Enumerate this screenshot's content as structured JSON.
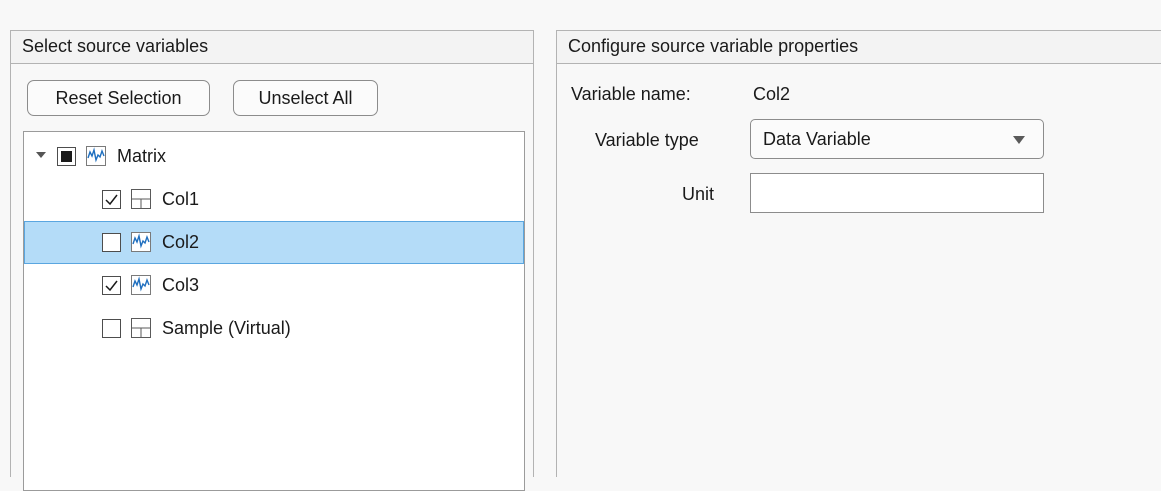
{
  "left_panel": {
    "title": "Select source variables",
    "buttons": {
      "reset_label": "Reset Selection",
      "unselect_all_label": "Unselect All"
    },
    "tree": {
      "root": {
        "label": "Matrix",
        "icon": "signal-icon",
        "checked": "partial",
        "expanded": true
      },
      "items": [
        {
          "label": "Col1",
          "icon": "table-icon",
          "checked": true,
          "selected": false
        },
        {
          "label": "Col2",
          "icon": "signal-icon",
          "checked": false,
          "selected": true
        },
        {
          "label": "Col3",
          "icon": "signal-icon",
          "checked": true,
          "selected": false
        },
        {
          "label": "Sample (Virtual)",
          "icon": "table-icon",
          "checked": false,
          "selected": false
        }
      ]
    }
  },
  "right_panel": {
    "title": "Configure source variable properties",
    "variable_name_label": "Variable name:",
    "variable_name_value": "Col2",
    "variable_type_label": "Variable type",
    "variable_type_value": "Data Variable",
    "unit_label": "Unit",
    "unit_value": ""
  },
  "colors": {
    "selection_fill": "#b4dcf8",
    "selection_border": "#5aa6e0",
    "signal_icon": "#1f6fbf"
  }
}
